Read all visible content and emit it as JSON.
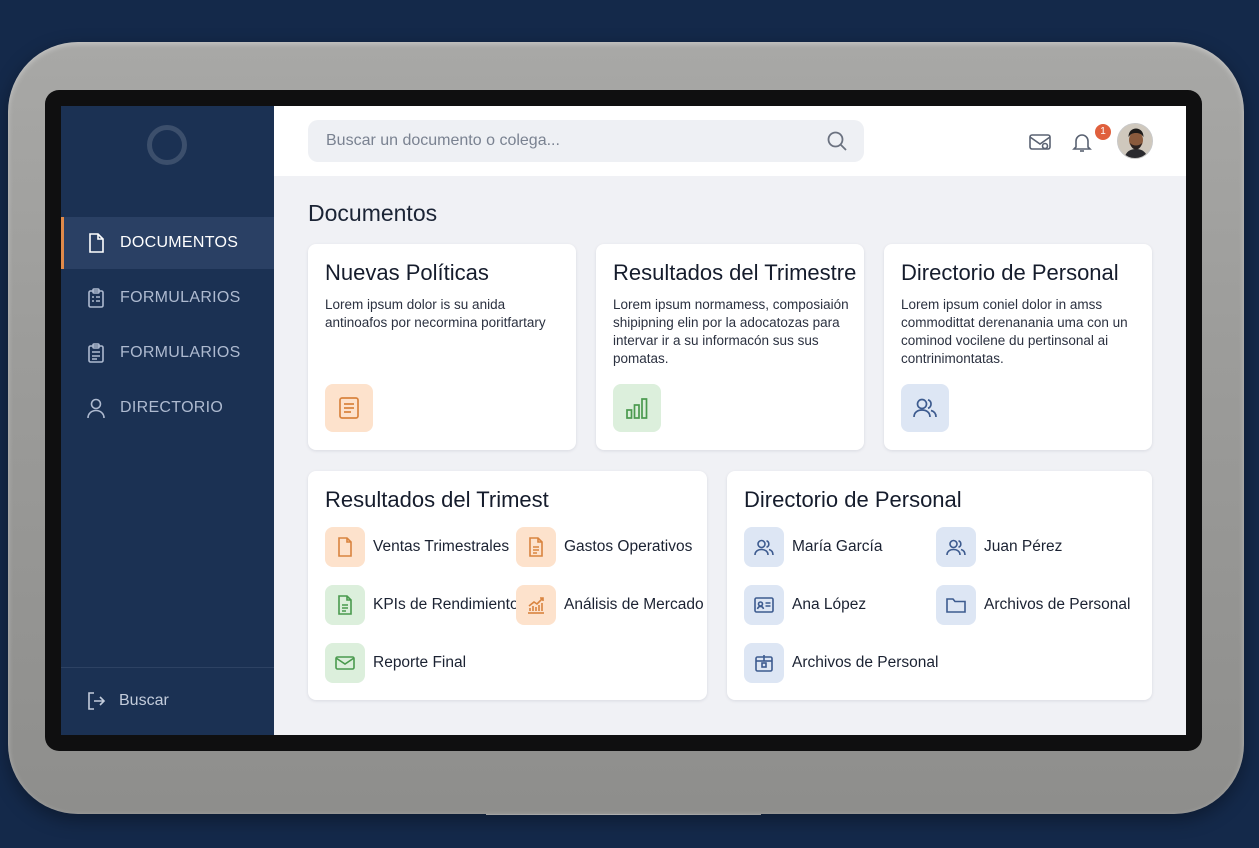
{
  "colors": {
    "background": "#14294a",
    "sidebar": "#1b3153",
    "accent": "#e08a4a",
    "badge": "#e0603d"
  },
  "sidebar": {
    "items": [
      {
        "label": "DOCUMENTOS",
        "icon": "document-icon",
        "active": true
      },
      {
        "label": "FORMULARIOS",
        "icon": "clipboard-icon",
        "active": false
      },
      {
        "label": "FORMULARIOS",
        "icon": "clipboard-icon",
        "active": false
      },
      {
        "label": "DIRECTORIO",
        "icon": "user-icon",
        "active": false
      }
    ],
    "footer": {
      "label": "Buscar",
      "icon": "logout-icon"
    }
  },
  "topbar": {
    "search_placeholder": "Buscar un documento o colega...",
    "notification_count": "1"
  },
  "main": {
    "title": "Documentos",
    "cards": [
      {
        "title": "Nuevas Políticas",
        "description": "Lorem ipsum dolor is su anida antinoafos por necormina poritfartary",
        "icon": "document-lines-icon"
      },
      {
        "title": "Resultados del Trimestre",
        "description": "Lorem ipsum normamess, composiaión shipipning elin por la adocatozas para intervar ir a su informacón sus sus pomatas.",
        "icon": "bar-chart-icon"
      },
      {
        "title": "Directorio de Personal",
        "description": "Lorem ipsum coniel dolor in amss commodittat derenanania uma con un cominod vocilene du pertinsonal ai contrinimontatas.",
        "icon": "users-icon"
      }
    ],
    "quarter_panel": {
      "title": "Resultados del Trimest",
      "items": [
        {
          "label": "Ventas Trimestrales",
          "icon": "file-icon"
        },
        {
          "label": "Gastos Operativos",
          "icon": "file-text-icon"
        },
        {
          "label": "KPIs de Rendimiento",
          "icon": "file-text-icon"
        },
        {
          "label": "Análisis de Mercado",
          "icon": "trend-chart-icon"
        },
        {
          "label": "Reporte Final",
          "icon": "mail-icon"
        }
      ]
    },
    "staff_panel": {
      "title": "Directorio de Personal",
      "items": [
        {
          "label": "María García",
          "icon": "users-icon"
        },
        {
          "label": "Juan Pérez",
          "icon": "users-icon"
        },
        {
          "label": "Ana López",
          "icon": "id-card-icon"
        },
        {
          "label": "Archivos de Personal",
          "icon": "folder-icon"
        },
        {
          "label": "Archivos de Personal",
          "icon": "archive-icon"
        }
      ]
    }
  }
}
